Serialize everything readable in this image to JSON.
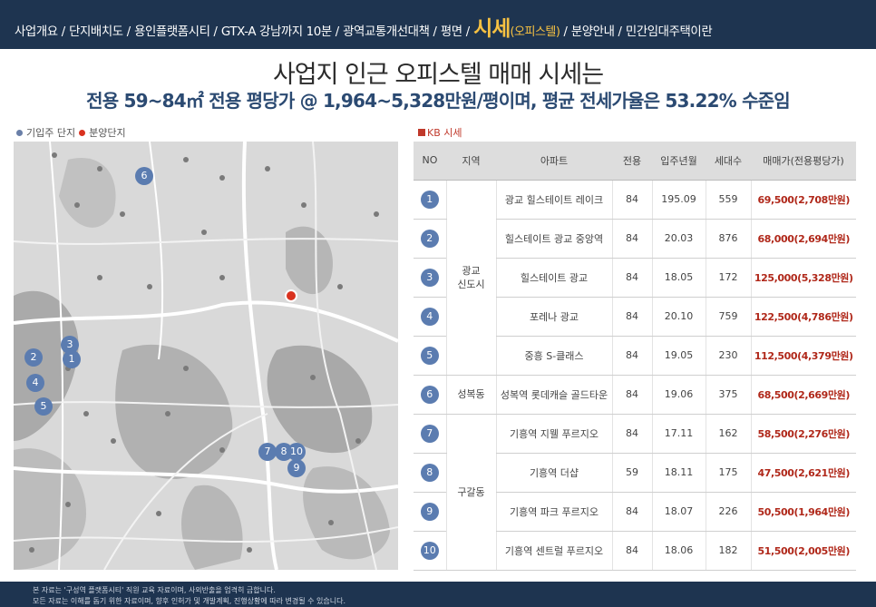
{
  "nav": {
    "items": [
      {
        "label": "사업개요",
        "active": false
      },
      {
        "label": "단지배치도",
        "active": false
      },
      {
        "label": "용인플랫폼시티",
        "active": false
      },
      {
        "label": "GTX-A 강남까지 10분",
        "active": false
      },
      {
        "label": "광역교통개선대책",
        "active": false
      },
      {
        "label": "평면",
        "active": false
      },
      {
        "label": "시세",
        "sub": "(오피스텔)",
        "active": true
      },
      {
        "label": "분양안내",
        "active": false
      },
      {
        "label": "민간임대주택이란",
        "active": false
      }
    ],
    "separator": "/"
  },
  "headline": "사업지 인근 오피스텔 매매 시세는",
  "subheadline": "전용 59~84㎡ 전용 평당가 @ 1,964~5,328만원/평이며, 평균 전세가율은 53.22% 수준임",
  "legend": {
    "blue_label": "기입주 단지",
    "red_label": "분양단지"
  },
  "kb_label": "KB 시세",
  "map": {
    "markers": [
      "1",
      "2",
      "3",
      "4",
      "5",
      "6",
      "7",
      "8",
      "10",
      "9"
    ]
  },
  "table": {
    "headers": [
      "NO",
      "지역",
      "아파트",
      "전용",
      "입주년월",
      "세대수",
      "매매가(전용평당가)"
    ],
    "rows": [
      {
        "no": "1",
        "apt": "광교 힐스테이트 레이크",
        "area": "84",
        "date": "195.09",
        "units": "559",
        "price": "69,500(2,708만원)"
      },
      {
        "no": "2",
        "apt": "힐스테이트 광교 중앙역",
        "area": "84",
        "date": "20.03",
        "units": "876",
        "price": "68,000(2,694만원)"
      },
      {
        "no": "3",
        "apt": "힐스테이트 광교",
        "area": "84",
        "date": "18.05",
        "units": "172",
        "price": "125,000(5,328만원)"
      },
      {
        "no": "4",
        "apt": "포레나 광교",
        "area": "84",
        "date": "20.10",
        "units": "759",
        "price": "122,500(4,786만원)"
      },
      {
        "no": "5",
        "apt": "중흥 S-클래스",
        "area": "84",
        "date": "19.05",
        "units": "230",
        "price": "112,500(4,379만원)"
      },
      {
        "no": "6",
        "apt": "성복역 롯데캐슬 골드타운",
        "area": "84",
        "date": "19.06",
        "units": "375",
        "price": "68,500(2,669만원)"
      },
      {
        "no": "7",
        "apt": "기흥역 지웰 푸르지오",
        "area": "84",
        "date": "17.11",
        "units": "162",
        "price": "58,500(2,276만원)"
      },
      {
        "no": "8",
        "apt": "기흥역 더샵",
        "area": "59",
        "date": "18.11",
        "units": "175",
        "price": "47,500(2,621만원)"
      },
      {
        "no": "9",
        "apt": "기흥역 파크 푸르지오",
        "area": "84",
        "date": "18.07",
        "units": "226",
        "price": "50,500(1,964만원)"
      },
      {
        "no": "10",
        "apt": "기흥역 센트럴 푸르지오",
        "area": "84",
        "date": "18.06",
        "units": "182",
        "price": "51,500(2,005만원)"
      }
    ],
    "regions": [
      {
        "name_line1": "광교",
        "name_line2": "신도시"
      },
      {
        "name_line1": "성복동",
        "name_line2": ""
      },
      {
        "name_line1": "구갈동",
        "name_line2": ""
      }
    ]
  },
  "footer": {
    "line1": "본 자료는 '구성역 플랫폼시티' 직원 교육 자료이며, 사외반출을 엄격히 금합니다.",
    "line2": "모든 자료는 이해를 돕기 위한 자료이며, 향후 인허가 및 개발계획, 진행상황에 따라 변경될 수 있습니다."
  },
  "colors": {
    "navy": "#1e3450",
    "active_nav": "#f6c142",
    "price_red": "#b0281a",
    "marker_blue": "#5b7cb0",
    "marker_red": "#d9321f"
  }
}
